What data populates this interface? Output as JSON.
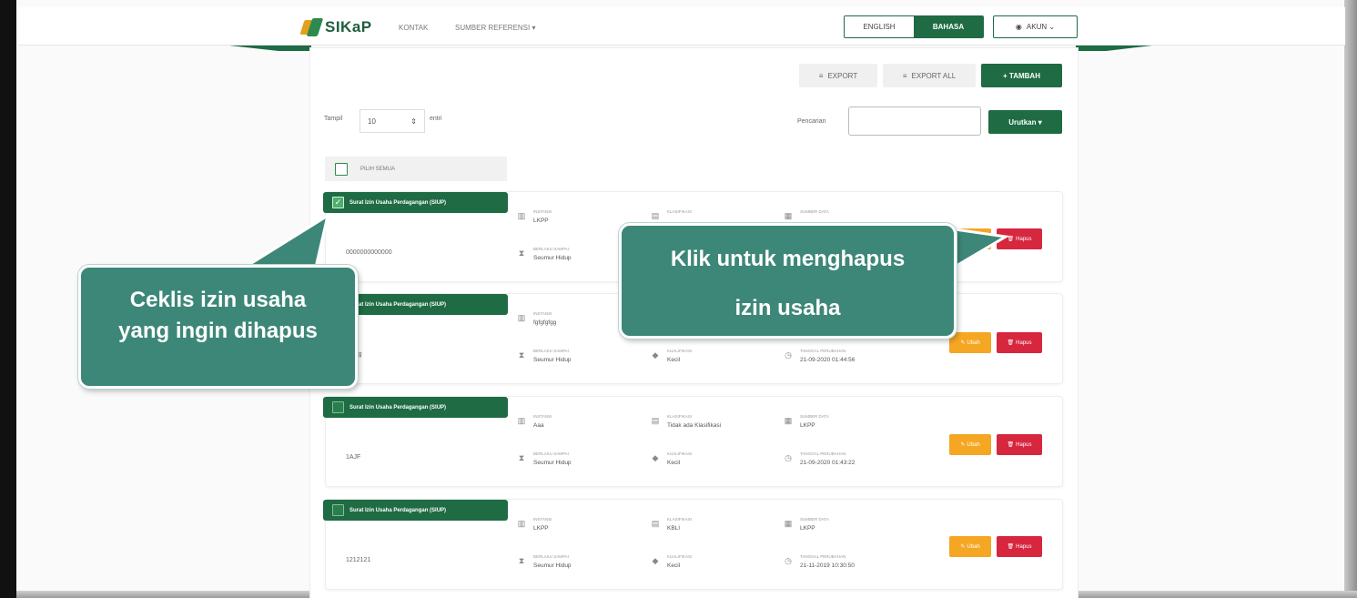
{
  "header": {
    "logo_text": "SIKaP",
    "nav": [
      "KONTAK",
      "SUMBER REFERENSI ▾"
    ],
    "lang_english": "ENGLISH",
    "lang_bahasa": "BAHASA",
    "account": "AKUN ⌄"
  },
  "toolbar": {
    "export": "EXPORT",
    "export_all": "EXPORT ALL",
    "tambah": "+ TAMBAH"
  },
  "controls": {
    "tampil": "Tampil",
    "page_size": "10",
    "entri": "entri",
    "pencarian": "Pencarian",
    "urutkan": "Urutkan ▾"
  },
  "select_all": "PILIH SEMUA",
  "cards": [
    {
      "tag": "Surat Izin Usaha Perdagangan (SIUP)",
      "checked": true,
      "number": "0000000000000",
      "instansi_label": "INSTANSI",
      "instansi": "LKPP",
      "berlaku_label": "BERLAKU SAMPAI",
      "berlaku": "Seumur Hidup",
      "klasifikasi_label": "KLASIFIKASI",
      "klasifikasi": "",
      "kualifikasi_label": "KUALIFIKASI",
      "kualifikasi": "",
      "sumber_label": "SUMBER DATA",
      "sumber": "",
      "tanggal_label": "TANGGAL PERUBAHAN",
      "tanggal": ""
    },
    {
      "tag": "Surat Izin Usaha Perdagangan (SIUP)",
      "checked": false,
      "number": "fgfgfg",
      "instansi_label": "INSTANSI",
      "instansi": "fgfgfgfgg",
      "berlaku_label": "BERLAKU SAMPAI",
      "berlaku": "Seumur Hidup",
      "klasifikasi_label": "KLASIFIKASI",
      "klasifikasi": "",
      "kualifikasi_label": "KUALIFIKASI",
      "kualifikasi": "Kecil",
      "sumber_label": "SUMBER DATA",
      "sumber": "",
      "tanggal_label": "TANGGAL PERUBAHAN",
      "tanggal": "21-09-2020 01:44:56"
    },
    {
      "tag": "Surat Izin Usaha Perdagangan (SIUP)",
      "checked": false,
      "number": "1AJF",
      "instansi_label": "INSTANSI",
      "instansi": "Aaa",
      "berlaku_label": "BERLAKU SAMPAI",
      "berlaku": "Seumur Hidup",
      "klasifikasi_label": "KLASIFIKASI",
      "klasifikasi": "Tidak ada Klasifikasi",
      "kualifikasi_label": "KUALIFIKASI",
      "kualifikasi": "Kecil",
      "sumber_label": "SUMBER DATA",
      "sumber": "LKPP",
      "tanggal_label": "TANGGAL PERUBAHAN",
      "tanggal": "21-09-2020 01:43:22"
    },
    {
      "tag": "Surat Izin Usaha Perdagangan (SIUP)",
      "checked": false,
      "number": "1212121",
      "instansi_label": "INSTANSI",
      "instansi": "LKPP",
      "berlaku_label": "BERLAKU SAMPAI",
      "berlaku": "Seumur Hidup",
      "klasifikasi_label": "KLASIFIKASI",
      "klasifikasi": "KBLI",
      "kualifikasi_label": "KUALIFIKASI",
      "kualifikasi": "Kecil",
      "sumber_label": "SUMBER DATA",
      "sumber": "LKPP",
      "tanggal_label": "TANGGAL PERUBAHAN",
      "tanggal": "21-11-2019 10:30:50"
    }
  ],
  "card_buttons": {
    "ubah": "Ubah",
    "hapus": "Hapus"
  },
  "callouts": {
    "left": [
      "Ceklis izin usaha",
      "yang ingin dihapus"
    ],
    "right": [
      "Klik untuk menghapus",
      "izin usaha"
    ]
  },
  "colors": {
    "primary": "#1e6b44",
    "callout": "#3d8778",
    "ubah": "#f5a623",
    "hapus": "#d6273f"
  }
}
